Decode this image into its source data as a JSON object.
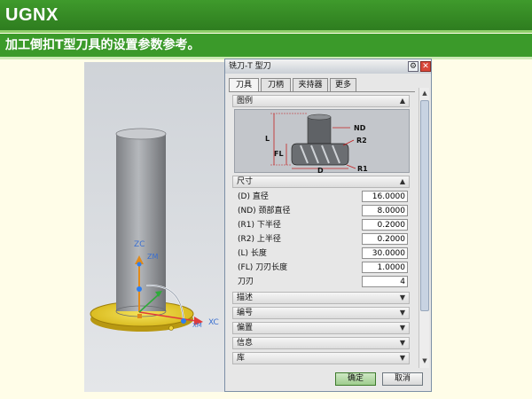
{
  "slide": {
    "title": "UGNX",
    "subtitle": "加工倒扣T型刀具的设置参数参考。"
  },
  "viewport": {
    "axes": {
      "zc": "ZC",
      "zm": "ZM",
      "xc": "XC",
      "xm": "XM"
    }
  },
  "dialog": {
    "title": "铣刀-T 型刀",
    "tabs": [
      {
        "label": "刀具",
        "active": true
      },
      {
        "label": "刀柄",
        "active": false
      },
      {
        "label": "夹持器",
        "active": false
      },
      {
        "label": "更多",
        "active": false
      }
    ],
    "sections": {
      "legend": "图例",
      "dimensions": "尺寸",
      "description": "描述",
      "number": "编号",
      "offset": "偏置",
      "info": "信息",
      "library": "库"
    },
    "diagram": {
      "labels": {
        "nd": "ND",
        "r2": "R2",
        "l": "L",
        "fl": "FL",
        "d": "D",
        "r1": "R1"
      }
    },
    "params": [
      {
        "label": "(D) 直径",
        "value": "16.0000"
      },
      {
        "label": "(ND) 颈部直径",
        "value": "8.0000"
      },
      {
        "label": "(R1) 下半径",
        "value": "0.2000"
      },
      {
        "label": "(R2) 上半径",
        "value": "0.2000"
      },
      {
        "label": "(L) 长度",
        "value": "30.0000"
      },
      {
        "label": "(FL) 刀刃长度",
        "value": "1.0000"
      },
      {
        "label": "刀刃",
        "value": "4"
      }
    ],
    "buttons": {
      "ok": "确定",
      "cancel": "取消"
    }
  }
}
